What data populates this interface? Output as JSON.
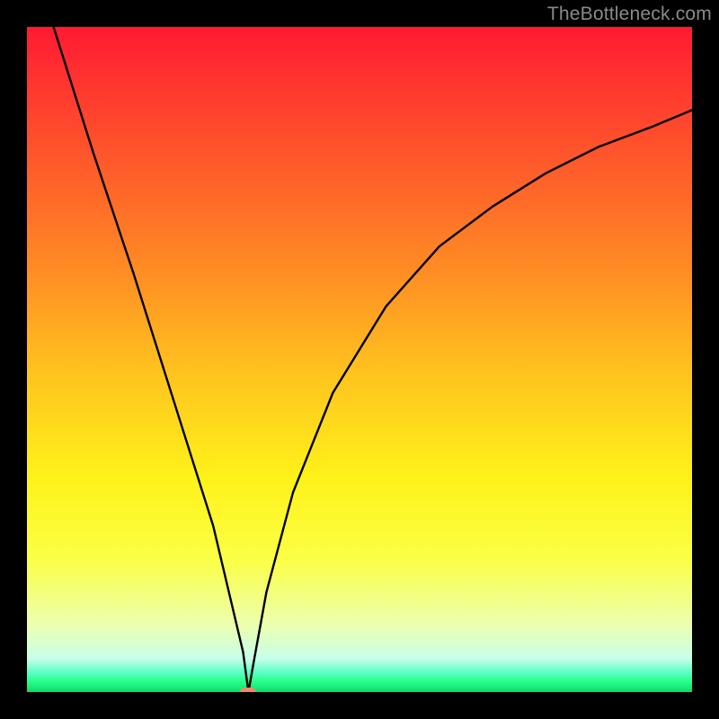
{
  "watermark": "TheBottleneck.com",
  "chart_data": {
    "type": "line",
    "title": "",
    "xlabel": "",
    "ylabel": "",
    "xlim": [
      0,
      100
    ],
    "ylim": [
      0,
      100
    ],
    "x": [
      4,
      10,
      16,
      22,
      28,
      32.5,
      33.3,
      34,
      36,
      40,
      46,
      54,
      62,
      70,
      78,
      86,
      94,
      100
    ],
    "values": [
      100,
      81,
      63,
      44,
      25,
      6,
      0,
      4,
      15,
      30,
      45,
      58,
      67,
      73,
      78,
      82,
      85,
      87.5
    ],
    "series": [
      {
        "name": "curve",
        "color": "#000000"
      }
    ],
    "marker": {
      "x": 33.3,
      "y": 0,
      "color": "#e98c6b"
    },
    "background_gradient": {
      "stops": [
        {
          "pos": 0,
          "color": "#ff1a33"
        },
        {
          "pos": 100,
          "color": "#12d66d"
        }
      ]
    }
  }
}
